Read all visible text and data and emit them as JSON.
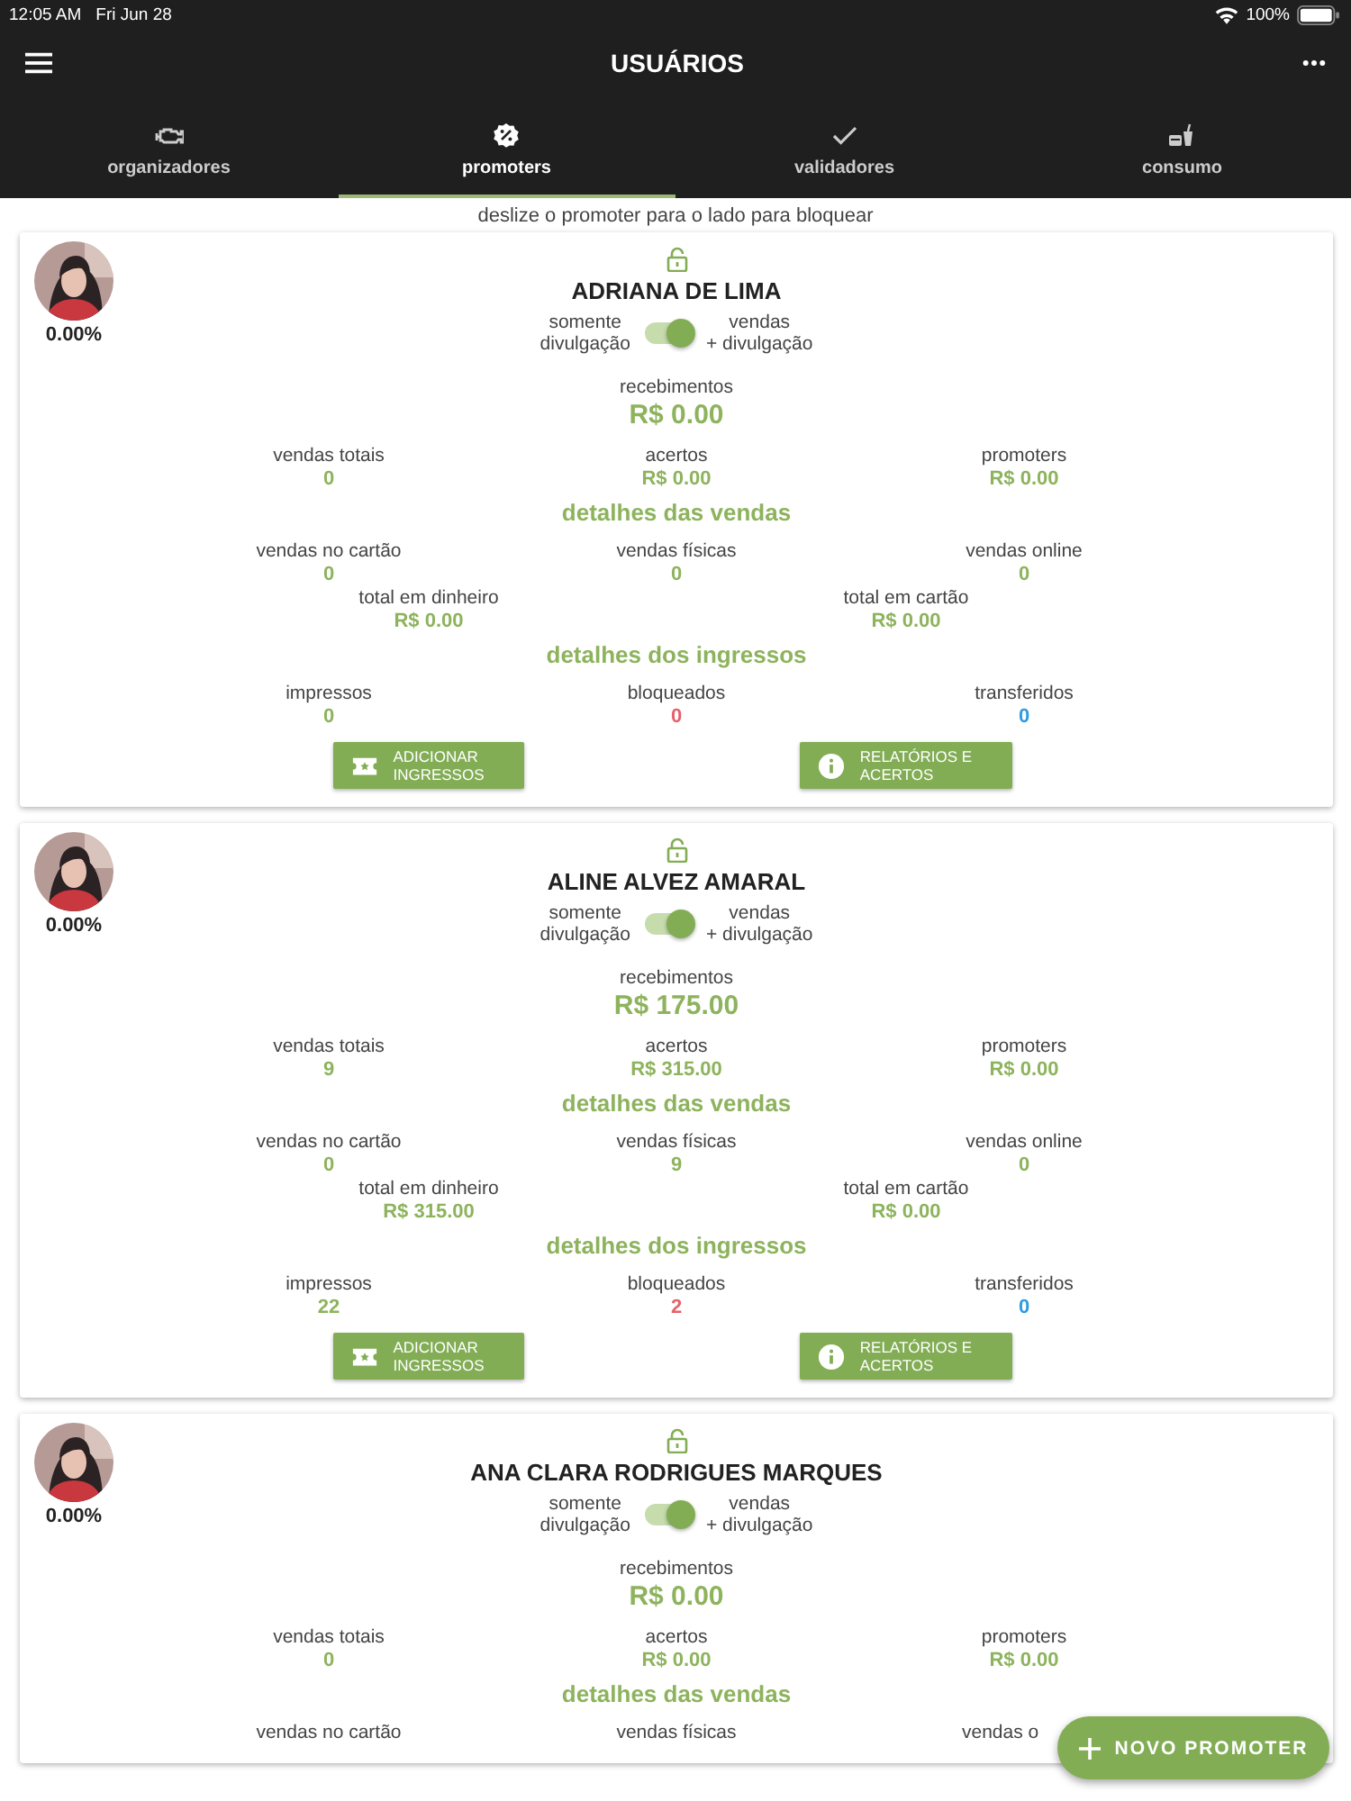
{
  "status_bar": {
    "time": "12:05 AM",
    "date": "Fri Jun 28",
    "battery": "100%"
  },
  "header": {
    "title": "USUÁRIOS"
  },
  "tabs": [
    {
      "label": "organizadores",
      "kind": "engine",
      "selected": false
    },
    {
      "label": "promoters",
      "kind": "badge",
      "selected": true
    },
    {
      "label": "validadores",
      "kind": "check",
      "selected": false
    },
    {
      "label": "consumo",
      "kind": "drink",
      "selected": false
    }
  ],
  "hint": "deslize o promoter para o lado para bloquear",
  "cards": [
    {
      "name": "ADRIANA DE LIMA",
      "percent": "0.00%",
      "mode_toggle": {
        "left": "somente\ndivulgação",
        "right": "vendas\n+ divulgação",
        "on": true
      },
      "receipts": {
        "label": "recebimentos",
        "value": "R$ 0.00"
      },
      "totals": [
        {
          "label": "vendas totais",
          "value": "0"
        },
        {
          "label": "acertos",
          "value": "R$ 0.00"
        },
        {
          "label": "promoters",
          "value": "R$ 0.00"
        }
      ],
      "sales_title": "detalhes das vendas",
      "sales": [
        {
          "label": "vendas no cartão",
          "value": "0"
        },
        {
          "label": "vendas físicas",
          "value": "0"
        },
        {
          "label": "vendas online",
          "value": "0"
        }
      ],
      "cash_card": [
        {
          "label": "total em dinheiro",
          "value": "R$ 0.00"
        },
        {
          "label": "total em cartão",
          "value": "R$ 0.00"
        }
      ],
      "tickets_title": "detalhes dos ingressos",
      "tickets": [
        {
          "label": "impressos",
          "value": "0",
          "color": "#8db35d"
        },
        {
          "label": "bloqueados",
          "value": "0",
          "color": "#e5616b"
        },
        {
          "label": "transferidos",
          "value": "0",
          "color": "#2f9be0"
        }
      ],
      "buttons": [
        {
          "label": "ADICIONAR\nINGRESSOS",
          "kind": "ticket"
        },
        {
          "label": "RELATÓRIOS E\nACERTOS",
          "kind": "info"
        }
      ]
    },
    {
      "name": "ALINE ALVEZ AMARAL",
      "percent": "0.00%",
      "mode_toggle": {
        "left": "somente\ndivulgação",
        "right": "vendas\n+ divulgação",
        "on": true
      },
      "receipts": {
        "label": "recebimentos",
        "value": "R$ 175.00"
      },
      "totals": [
        {
          "label": "vendas totais",
          "value": "9"
        },
        {
          "label": "acertos",
          "value": "R$ 315.00"
        },
        {
          "label": "promoters",
          "value": "R$ 0.00"
        }
      ],
      "sales_title": "detalhes das vendas",
      "sales": [
        {
          "label": "vendas no cartão",
          "value": "0"
        },
        {
          "label": "vendas físicas",
          "value": "9"
        },
        {
          "label": "vendas online",
          "value": "0"
        }
      ],
      "cash_card": [
        {
          "label": "total em dinheiro",
          "value": "R$ 315.00"
        },
        {
          "label": "total em cartão",
          "value": "R$ 0.00"
        }
      ],
      "tickets_title": "detalhes dos ingressos",
      "tickets": [
        {
          "label": "impressos",
          "value": "22",
          "color": "#8db35d"
        },
        {
          "label": "bloqueados",
          "value": "2",
          "color": "#e5616b"
        },
        {
          "label": "transferidos",
          "value": "0",
          "color": "#2f9be0"
        }
      ],
      "buttons": [
        {
          "label": "ADICIONAR\nINGRESSOS",
          "kind": "ticket"
        },
        {
          "label": "RELATÓRIOS E\nACERTOS",
          "kind": "info"
        }
      ]
    },
    {
      "name": "ANA CLARA RODRIGUES MARQUES",
      "percent": "0.00%",
      "mode_toggle": {
        "left": "somente\ndivulgação",
        "right": "vendas\n+ divulgação",
        "on": true
      },
      "receipts": {
        "label": "recebimentos",
        "value": "R$ 0.00"
      },
      "totals": [
        {
          "label": "vendas totais",
          "value": "0"
        },
        {
          "label": "acertos",
          "value": "R$ 0.00"
        },
        {
          "label": "promoters",
          "value": "R$ 0.00"
        }
      ],
      "sales_title": "detalhes das vendas",
      "sales": [
        {
          "label": "vendas no cartão"
        },
        {
          "label": "vendas físicas"
        },
        {
          "label": "vendas o"
        }
      ]
    }
  ],
  "fab": {
    "label": "NOVO PROMOTER"
  }
}
